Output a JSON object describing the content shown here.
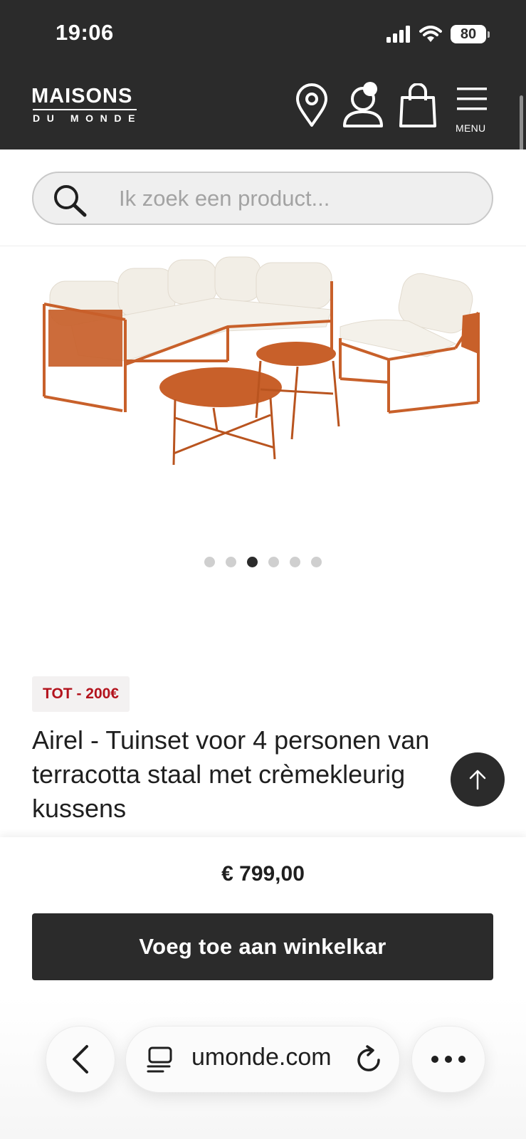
{
  "status_bar": {
    "time": "19:06",
    "battery": "80"
  },
  "header": {
    "logo_line1": "MAISONS",
    "logo_line2": "DU MONDE",
    "menu_label": "MENU",
    "icons": [
      "location-pin-icon",
      "account-icon",
      "shopping-bag-icon",
      "hamburger-menu-icon"
    ]
  },
  "search": {
    "placeholder": "Ik zoek een product..."
  },
  "gallery": {
    "image_count": 6,
    "active_index": 2
  },
  "product": {
    "badge": "TOT - 200€",
    "title_lines": [
      "Airel - Tuinset voor 4 personen van",
      "terracotta staal met crèmekleurig",
      "kussens"
    ],
    "price": "€ 799,00",
    "add_to_cart": "Voeg toe aan winkelkar"
  },
  "browser": {
    "url": "umonde.com"
  },
  "colors": {
    "header_bg": "#2b2b2b",
    "badge_text": "#b3131d",
    "terracotta": "#c8602a",
    "cushion": "#f2eee6"
  }
}
